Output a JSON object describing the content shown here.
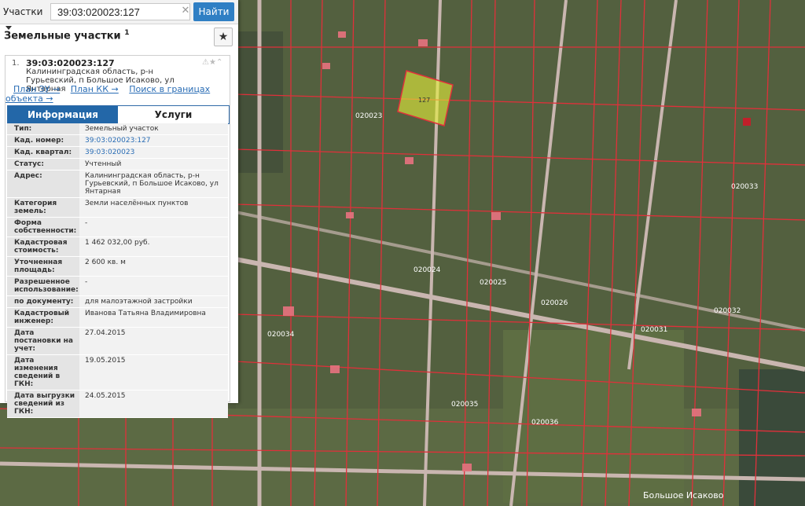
{
  "search": {
    "type_label": "Участки",
    "query": "39:03:020023:127",
    "button_label": "Найти"
  },
  "panel": {
    "heading": "Земельные участки",
    "heading_note": "1",
    "result_number": "1.",
    "cad_number": "39:03:020023:127",
    "address": "Калининградская область, р-н Гурьевский, п Большое Исаково, ул Янтарная",
    "links": {
      "plan_zu": "План ЗУ →",
      "plan_kk": "План КК →",
      "find_bounds": "Поиск в границах объекта →"
    },
    "tabs": {
      "info": "Информация",
      "services": "Услуги"
    },
    "rows": [
      {
        "k": "Тип:",
        "v": "Земельный участок"
      },
      {
        "k": "Кад. номер:",
        "v": "39:03:020023:127"
      },
      {
        "k": "Кад. квартал:",
        "v": "39:03:020023"
      },
      {
        "k": "Статус:",
        "v": "Учтенный"
      },
      {
        "k": "Адрес:",
        "v": "Калининградская область, р-н Гурьевский, п Большое Исаково, ул Янтарная"
      },
      {
        "k": "Категория земель:",
        "v": "Земли населённых пунктов"
      },
      {
        "k": "Форма собственности:",
        "v": "-"
      },
      {
        "k": "Кадастровая стоимость:",
        "v": "1 462 032,00 руб."
      },
      {
        "k": "Уточненная площадь:",
        "v": "2 600 кв. м"
      },
      {
        "k": "Разрешенное использование:",
        "v": "-"
      },
      {
        "k": "по документу:",
        "v": "для малоэтажной застройки"
      },
      {
        "k": "Кадастровый инженер:",
        "v": "Иванова Татьяна Владимировна"
      },
      {
        "k": "Дата постановки на учет:",
        "v": "27.04.2015"
      },
      {
        "k": "Дата изменения сведений в ГКН:",
        "v": "19.05.2015"
      },
      {
        "k": "Дата выгрузки сведений из ГКН:",
        "v": "24.05.2015"
      }
    ]
  },
  "map": {
    "quarter_labels": [
      "020023",
      "020024",
      "020025",
      "020026",
      "020031",
      "020032",
      "020034",
      "020035",
      "020036",
      "020033"
    ],
    "parcel_label": "127",
    "place_name": "Большое Исаково"
  },
  "colors": {
    "accent": "#2f7fc4",
    "boundary": "#e0303a",
    "highlight": "#e7f23a"
  }
}
